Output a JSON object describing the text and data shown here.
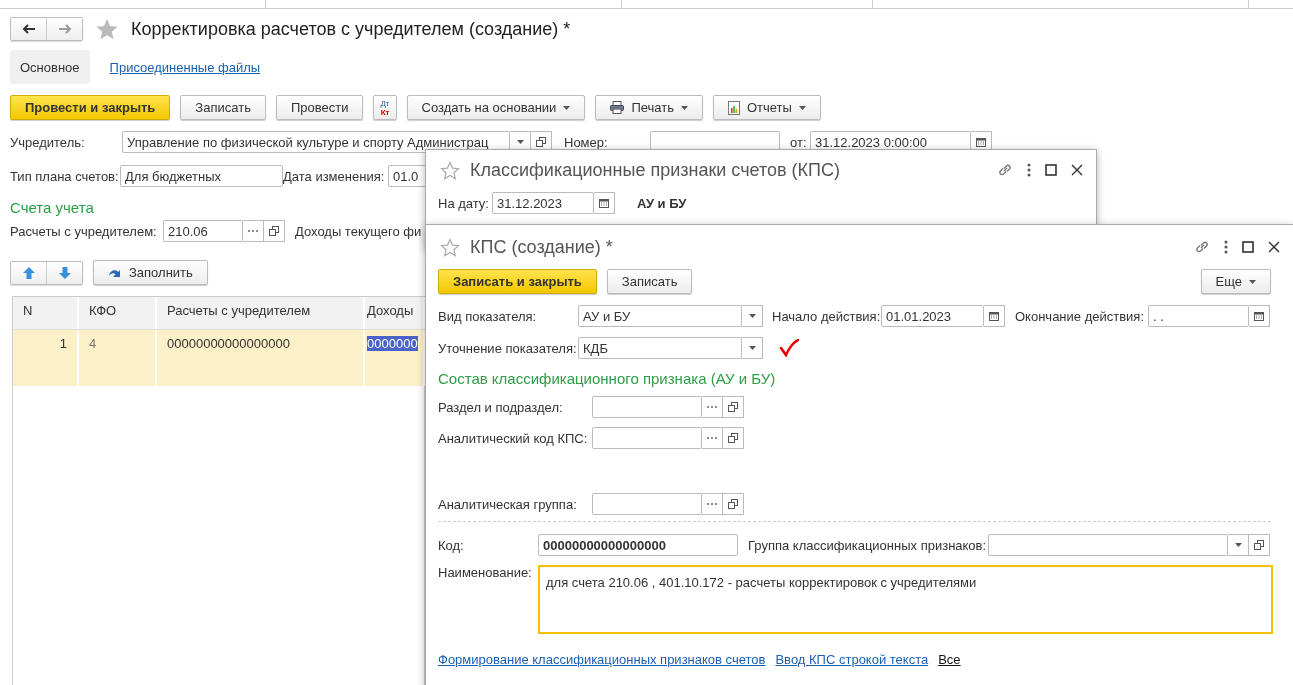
{
  "document": {
    "title": "Корректировка расчетов с учредителем (создание) *",
    "tabs": [
      {
        "label": "Основное",
        "selected": true
      },
      {
        "label": "Присоединенные файлы",
        "selected": false
      }
    ],
    "toolbar": [
      {
        "kind": "primary",
        "label": "Провести и закрыть"
      },
      {
        "kind": "plain",
        "label": "Записать"
      },
      {
        "kind": "plain",
        "label": "Провести"
      },
      {
        "kind": "dtkt",
        "top": "Дт",
        "bottom": "Кт"
      },
      {
        "kind": "menu",
        "label": "Создать на основании"
      },
      {
        "kind": "print_menu",
        "label": "Печать"
      },
      {
        "kind": "report_menu",
        "label": "Отчеты"
      }
    ],
    "founder": {
      "label": "Учредитель:",
      "value": "Управление по физической культуре и спорту  Администрац"
    },
    "number": {
      "label": "Номер:"
    },
    "date": {
      "label": "от:",
      "value": "31.12.2023  0:00:00"
    },
    "plan_type": {
      "label": "Тип плана счетов:",
      "value": "Для бюджетных"
    },
    "change_date": {
      "label": "Дата изменения:",
      "value": "01.0"
    },
    "accounts_heading": "Счета учета",
    "settlements": {
      "label": "Расчеты с учредителем:",
      "value": "210.06"
    },
    "income_label": "Доходы текущего фи",
    "fill_button": "Заполнить",
    "table": {
      "columns": [
        "N",
        "КФО",
        "Расчеты с учредителем",
        "Доходы"
      ],
      "rows": [
        {
          "cells": [
            "1",
            "4",
            "00000000000000000",
            "0000000"
          ],
          "selected": true
        }
      ]
    }
  },
  "kps_list": {
    "title": "Классификационные признаки счетов (КПС)",
    "date": {
      "label": "На дату:",
      "value": "31.12.2023"
    },
    "scope": "АУ и БУ"
  },
  "kps_form": {
    "title": "КПС (создание) *",
    "toolbar": [
      {
        "kind": "primary",
        "label": "Записать и закрыть"
      },
      {
        "kind": "plain",
        "label": "Записать"
      }
    ],
    "more_button": "Еще",
    "indicator_type": {
      "label": "Вид показателя:",
      "value": "АУ и БУ"
    },
    "start": {
      "label": "Начало действия:",
      "value": "01.01.2023"
    },
    "end": {
      "label": "Окончание действия:",
      "value": ".  ."
    },
    "refinement": {
      "label": "Уточнение показателя:",
      "value": "КДБ"
    },
    "composition_heading": "Состав классификационного признака (АУ и БУ)",
    "composition_fields": [
      {
        "label": "Раздел и подраздел:"
      },
      {
        "label": "Аналитический код КПС:"
      },
      {
        "label": "Аналитическая группа:"
      }
    ],
    "code": {
      "label": "Код:",
      "value": "00000000000000000"
    },
    "group": {
      "label": "Группа классификационных признаков:"
    },
    "name": {
      "label": "Наименование:",
      "value": "для счета 210.06 , 401.10.172 - расчеты корректировок с учредителями"
    },
    "links": [
      {
        "kind": "link",
        "label": "Формирование классификационных признаков счетов"
      },
      {
        "kind": "link",
        "label": "Ввод КПС строкой текста"
      },
      {
        "kind": "plain_link",
        "label": "Все"
      }
    ]
  }
}
